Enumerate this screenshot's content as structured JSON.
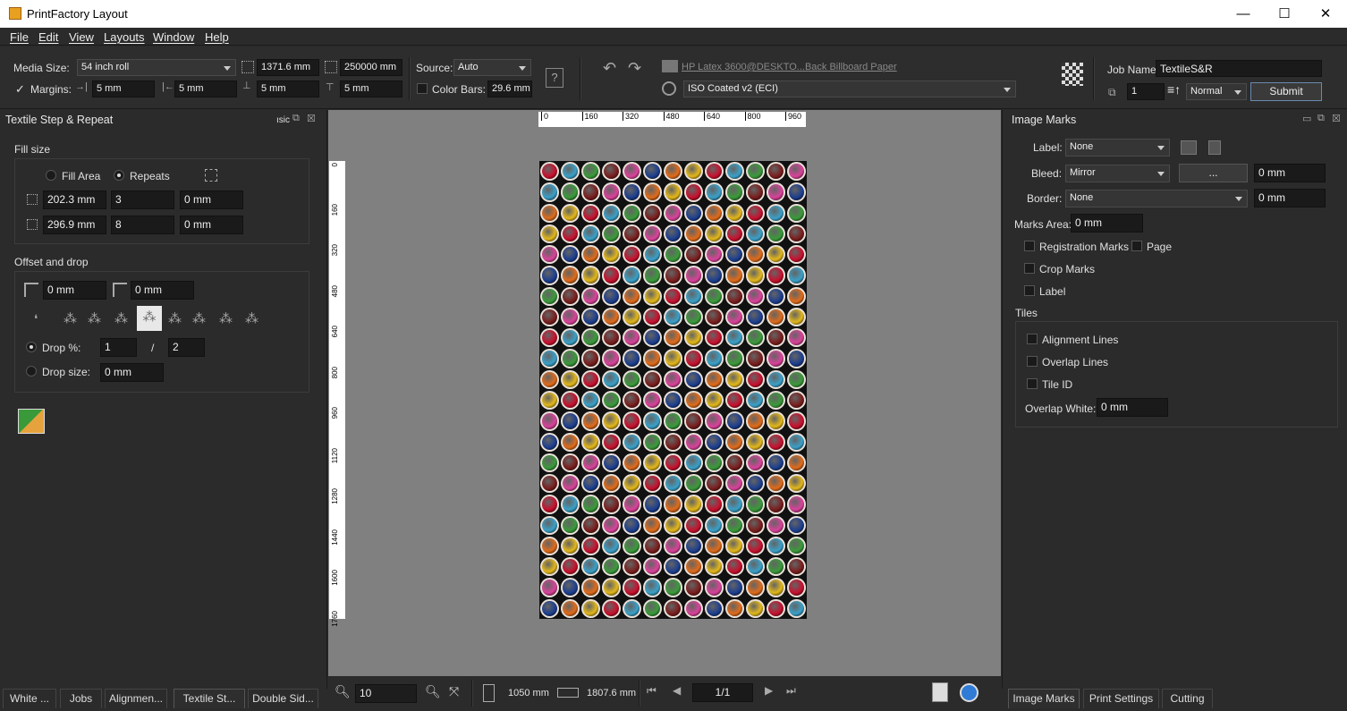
{
  "window": {
    "title": "PrintFactory Layout",
    "minimize": "—",
    "maximize": "☐",
    "close": "✕"
  },
  "menu": [
    "File",
    "Edit",
    "View",
    "Layouts",
    "Window",
    "Help"
  ],
  "toolbar": {
    "media_size_label": "Media Size:",
    "media_size_value": "54 inch roll",
    "width_value": "1371.6 mm",
    "length_value": "250000 mm",
    "margins_label": "Margins:",
    "margin_right": "5 mm",
    "margin_left": "5 mm",
    "margin_bottom": "5 mm",
    "margin_top": "5 mm",
    "source_label": "Source:",
    "source_value": "Auto",
    "color_bars_label": "Color Bars:",
    "color_bars_value": "29.6 mm",
    "printer": "HP Latex 3600@DESKTO...Back Billboard Paper",
    "profile": "ISO Coated v2 (ECI)",
    "job_name_label": "Job Name:",
    "job_name_value": "TextileS&R",
    "copies": "1",
    "priority": "Normal",
    "submit": "Submit"
  },
  "left_panel": {
    "title": "Textile Step & Repeat",
    "tab_hint": "ısic",
    "fill_size_label": "Fill size",
    "fill_area_label": "Fill Area",
    "repeats_label": "Repeats",
    "row1": {
      "size": "202.3 mm",
      "count": "3",
      "gap": "0 mm"
    },
    "row2": {
      "size": "296.9 mm",
      "count": "8",
      "gap": "0 mm"
    },
    "offset_label": "Offset and drop",
    "offset_x": "0 mm",
    "offset_y": "0 mm",
    "drop_pct_label": "Drop %:",
    "drop_num": "1",
    "drop_slash": "/",
    "drop_den": "2",
    "drop_size_label": "Drop size:",
    "drop_size_value": "0 mm"
  },
  "ruler_h": [
    "0",
    "160",
    "320",
    "480",
    "640",
    "800",
    "960"
  ],
  "ruler_v": [
    "0",
    "160",
    "320",
    "480",
    "640",
    "800",
    "960",
    "1120",
    "1280",
    "1440",
    "1600",
    "1760"
  ],
  "bottom": {
    "zoom": "10",
    "width": "1050 mm",
    "height": "1807.6 mm",
    "page": "1/1"
  },
  "left_tabs": [
    "White ...",
    "Jobs",
    "Alignmen...",
    "Textile St...",
    "Double Sid..."
  ],
  "right_panel": {
    "title": "Image Marks",
    "label_label": "Label:",
    "label_value": "None",
    "bleed_label": "Bleed:",
    "bleed_value": "Mirror",
    "bleed_btn": "...",
    "bleed_mm": "0 mm",
    "border_label": "Border:",
    "border_value": "None",
    "border_mm": "0 mm",
    "marks_area_label": "Marks Area:",
    "marks_area_value": "0 mm",
    "registration_marks": "Registration Marks",
    "page": "Page",
    "crop_marks": "Crop Marks",
    "label_chk": "Label",
    "tiles_label": "Tiles",
    "alignment_lines": "Alignment Lines",
    "overlap_lines": "Overlap Lines",
    "tile_id": "Tile ID",
    "overlap_white_label": "Overlap White:",
    "overlap_white_value": "0 mm"
  },
  "right_tabs": [
    "Image Marks",
    "Print Settings",
    "Cutting"
  ],
  "colors": {
    "dot_palette": [
      "#c8102e",
      "#1d3f8f",
      "#3a9a3a",
      "#e3b71a",
      "#d9429a",
      "#3aa0c8",
      "#e06b1a",
      "#7a1e1e"
    ]
  }
}
